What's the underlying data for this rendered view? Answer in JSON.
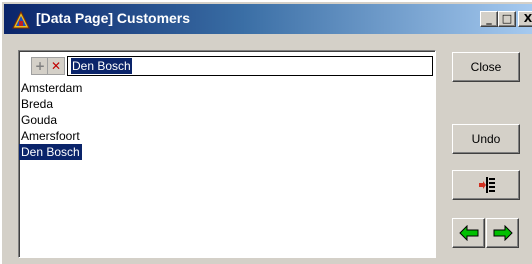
{
  "window": {
    "title": "[Data Page] Customers",
    "controls": {
      "minimize": "_",
      "maximize": "□",
      "close": "X"
    }
  },
  "toolbar": {
    "add_icon": "plus-icon",
    "delete_icon": "delete-x-icon",
    "edit_value": "Den Bosch"
  },
  "list": {
    "items": [
      "Amsterdam",
      "Breda",
      "Gouda",
      "Amersfoort",
      "Den Bosch"
    ],
    "selected_index": 4
  },
  "buttons": {
    "close": "Close",
    "undo": "Undo",
    "sort_icon": "insert-tree-icon",
    "prev_icon": "arrow-left-icon",
    "next_icon": "arrow-right-icon"
  },
  "colors": {
    "title_start": "#0a246a",
    "title_end": "#a6caf0",
    "selection": "#0a246a",
    "arrow": "#00c000",
    "delete": "#c00000"
  }
}
